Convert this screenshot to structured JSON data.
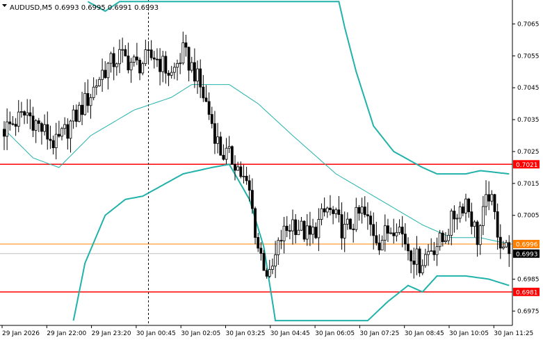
{
  "chart_data": {
    "type": "candlestick",
    "title": "AUDUSD,M5  0.6993 0.6995 0.6991 0.6993",
    "symbol": "AUDUSD,M5",
    "ohlc_header": "0.6993 0.6995 0.6991 0.6993",
    "ylim": [
      0.69705,
      0.70725
    ],
    "y_ticks": [
      "0.7065",
      "0.7055",
      "0.7045",
      "0.7035",
      "0.7025",
      "0.7015",
      "0.7005",
      "0.6985",
      "0.6975"
    ],
    "x_tick_labels": [
      "29 Jan 2026",
      "29 Jan 22:00",
      "29 Jan 23:20",
      "30 Jan 00:45",
      "30 Jan 02:05",
      "30 Jan 03:25",
      "30 Jan 04:45",
      "30 Jan 06:05",
      "30 Jan 07:25",
      "30 Jan 08:45",
      "30 Jan 10:05",
      "30 Jan 11:25"
    ],
    "candle_count": 176,
    "price_keypoints": [
      [
        0,
        0.7032
      ],
      [
        8,
        0.7037
      ],
      [
        14,
        0.7031
      ],
      [
        18,
        0.7027
      ],
      [
        24,
        0.7035
      ],
      [
        30,
        0.7043
      ],
      [
        34,
        0.705
      ],
      [
        40,
        0.7055
      ],
      [
        46,
        0.7052
      ],
      [
        52,
        0.7055
      ],
      [
        58,
        0.7049
      ],
      [
        62,
        0.7056
      ],
      [
        66,
        0.705
      ],
      [
        70,
        0.704
      ],
      [
        75,
        0.7025
      ],
      [
        80,
        0.7022
      ],
      [
        85,
        0.7012
      ],
      [
        88,
        0.6995
      ],
      [
        92,
        0.6985
      ],
      [
        96,
        0.6998
      ],
      [
        100,
        0.7003
      ],
      [
        106,
        0.6998
      ],
      [
        112,
        0.7007
      ],
      [
        118,
        0.7
      ],
      [
        124,
        0.7006
      ],
      [
        130,
        0.6997
      ],
      [
        136,
        0.7003
      ],
      [
        140,
        0.6995
      ],
      [
        144,
        0.699
      ],
      [
        148,
        0.6995
      ],
      [
        152,
        0.6997
      ],
      [
        156,
        0.7005
      ],
      [
        160,
        0.701
      ],
      [
        164,
        0.6998
      ],
      [
        168,
        0.7012
      ],
      [
        172,
        0.6997
      ],
      [
        175,
        0.6993
      ]
    ],
    "bollinger_bands": {
      "middle": [
        [
          0,
          0.7032
        ],
        [
          10,
          0.7023
        ],
        [
          19,
          0.702
        ],
        [
          30,
          0.703
        ],
        [
          45,
          0.7038
        ],
        [
          58,
          0.7042
        ],
        [
          65,
          0.7046
        ],
        [
          78,
          0.7046
        ],
        [
          88,
          0.704
        ],
        [
          100,
          0.703
        ],
        [
          115,
          0.7018
        ],
        [
          130,
          0.701
        ],
        [
          145,
          0.7002
        ],
        [
          155,
          0.6998
        ],
        [
          165,
          0.6998
        ],
        [
          175,
          0.6996
        ]
      ],
      "upper": [
        [
          29,
          0.7072
        ],
        [
          35,
          0.7069
        ],
        [
          40,
          0.7072
        ],
        [
          116,
          0.7072
        ],
        [
          118,
          0.7064
        ],
        [
          122,
          0.705
        ],
        [
          128,
          0.7033
        ],
        [
          135,
          0.7025
        ],
        [
          145,
          0.702
        ],
        [
          150,
          0.7018
        ],
        [
          160,
          0.7018
        ],
        [
          165,
          0.7019
        ],
        [
          175,
          0.7018
        ]
      ],
      "lower": [
        [
          24,
          0.6972
        ],
        [
          28,
          0.699
        ],
        [
          35,
          0.7005
        ],
        [
          42,
          0.701
        ],
        [
          48,
          0.7011
        ],
        [
          56,
          0.7015
        ],
        [
          62,
          0.7018
        ],
        [
          72,
          0.702
        ],
        [
          78,
          0.7021
        ],
        [
          85,
          0.701
        ],
        [
          90,
          0.6995
        ],
        [
          94,
          0.6972
        ],
        [
          126,
          0.6972
        ],
        [
          133,
          0.6978
        ],
        [
          140,
          0.6983
        ],
        [
          145,
          0.6981
        ],
        [
          150,
          0.6986
        ],
        [
          160,
          0.6986
        ],
        [
          168,
          0.6985
        ],
        [
          175,
          0.6983
        ]
      ]
    },
    "horizontal_lines": [
      {
        "price": 0.7021,
        "label": "0.7021",
        "color": "#ff0000"
      },
      {
        "price": 0.6996,
        "label": "0.6996",
        "color": "#ff8000"
      },
      {
        "price": 0.6981,
        "label": "0.6981",
        "color": "#ff0000"
      }
    ],
    "current_price": {
      "price": 0.6993,
      "label": "0.6993"
    },
    "vertical_marker_index": 50,
    "colors": {
      "candle": "#000000",
      "bands": "#20b2aa",
      "current_badge": "#000000",
      "background": "#ffffff"
    }
  }
}
